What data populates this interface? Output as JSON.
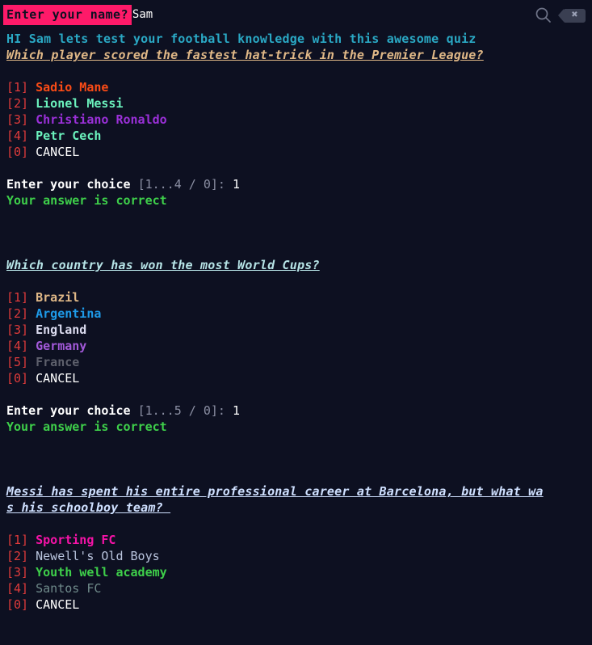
{
  "header": {
    "name_prompt": "Enter your name?",
    "name_value": "Sam",
    "search_icon": "search-icon",
    "backspace_icon": "backspace-icon",
    "backspace_glyph": "✖"
  },
  "greeting": "HI Sam lets test your football knowledge with this awesome quiz",
  "quiz": [
    {
      "question": "Which player scored the fastest hat-trick in the Premier League?",
      "question_color": "#e0b887",
      "options": [
        {
          "key": "[1]",
          "label": "Sadio Mane",
          "color": "#fa4b16"
        },
        {
          "key": "[2]",
          "label": "Lionel Messi",
          "color": "#6bf2bd"
        },
        {
          "key": "[3]",
          "label": "Christiano Ronaldo",
          "color": "#9b30d9"
        },
        {
          "key": "[4]",
          "label": "Petr Cech",
          "color": "#6bf2bd"
        },
        {
          "key": "[0]",
          "label": "CANCEL",
          "color": "#ffffff"
        }
      ],
      "prompt_label": "Enter your choice",
      "prompt_range": "[1...4 / 0]:",
      "prompt_answer": "1",
      "result": "Your answer is correct"
    },
    {
      "question": "Which country has won the most World Cups?",
      "question_color": "#b6e3e6",
      "options": [
        {
          "key": "[1]",
          "label": "Brazil",
          "color": "#e0b887"
        },
        {
          "key": "[2]",
          "label": "Argentina",
          "color": "#1e9ae8"
        },
        {
          "key": "[3]",
          "label": "England",
          "color": "#dcdcf0"
        },
        {
          "key": "[4]",
          "label": "Germany",
          "color": "#a259d9"
        },
        {
          "key": "[5]",
          "label": "France",
          "color": "#5d5f6b"
        },
        {
          "key": "[0]",
          "label": "CANCEL",
          "color": "#ffffff"
        }
      ],
      "prompt_label": "Enter your choice",
      "prompt_range": "[1...5 / 0]:",
      "prompt_answer": "1",
      "result": "Your answer is correct"
    },
    {
      "question_line1": "Messi has spent his entire professional career at Barcelona, but what wa",
      "question_line2": "s his schoolboy team? ",
      "question_color": "#cfe0ff",
      "options": [
        {
          "key": "[1]",
          "label": "Sporting FC",
          "color": "#f513a7"
        },
        {
          "key": "[2]",
          "label": "Newell's Old Boys",
          "color": "#b9c4dd"
        },
        {
          "key": "[3]",
          "label": "Youth well academy",
          "color": "#3ecf4a"
        },
        {
          "key": "[4]",
          "label": "Santos FC",
          "color": "#6f8a8a"
        },
        {
          "key": "[0]",
          "label": "CANCEL",
          "color": "#ffffff"
        }
      ]
    }
  ],
  "colors": {
    "background": "#0d1021",
    "prompt_highlight": "#fe1a69",
    "greeting": "#2aa8c4",
    "bracket": "#e03b3b",
    "success": "#3ecf4a"
  }
}
